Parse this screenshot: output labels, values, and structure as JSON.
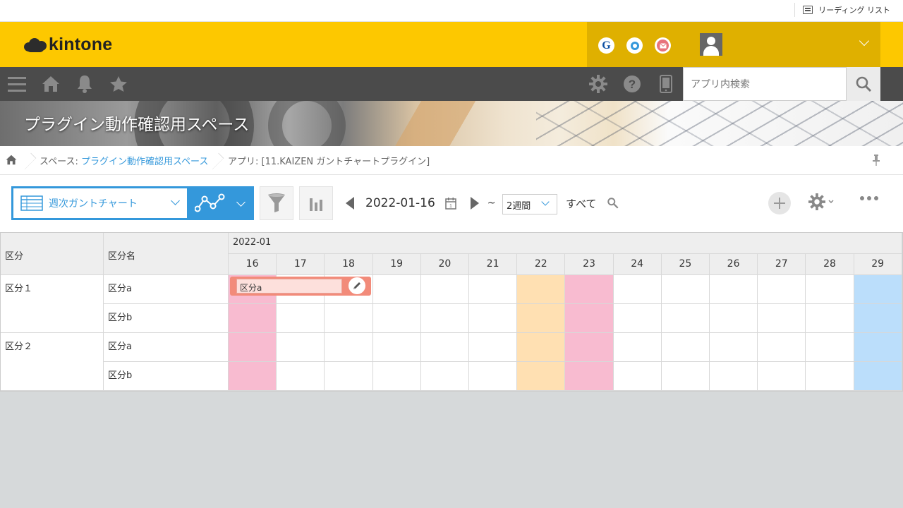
{
  "browser": {
    "reading_list_label": "リーディング リスト"
  },
  "header": {
    "logo_text": "kintone",
    "services": [
      {
        "icon": "garoon-icon",
        "glyph": "G",
        "color": "#0b4ea2"
      },
      {
        "icon": "office-icon",
        "glyph": "",
        "color": "#3498db"
      },
      {
        "icon": "mail-icon",
        "glyph": "",
        "color": "#e8737c"
      }
    ]
  },
  "nav": {
    "search_placeholder": "アプリ内検索"
  },
  "banner": {
    "title": "プラグイン動作確認用スペース"
  },
  "breadcrumb": {
    "space_prefix": "スペース: ",
    "space_link": "プラグイン動作確認用スペース",
    "app": "アプリ: [11.KAIZEN ガントチャートプラグイン]"
  },
  "toolbar": {
    "view_name": "週次ガントチャート",
    "date": "2022-01-16",
    "tilde": "~",
    "period": "2週間",
    "filter_all": "すべて"
  },
  "gantt": {
    "col_category": "区分",
    "col_category_name": "区分名",
    "month": "2022-01",
    "days": [
      {
        "label": "16",
        "color": "#f8bbd0"
      },
      {
        "label": "17",
        "color": ""
      },
      {
        "label": "18",
        "color": ""
      },
      {
        "label": "19",
        "color": ""
      },
      {
        "label": "20",
        "color": ""
      },
      {
        "label": "21",
        "color": ""
      },
      {
        "label": "22",
        "color": "#ffe0b2"
      },
      {
        "label": "23",
        "color": "#f8bbd0"
      },
      {
        "label": "24",
        "color": ""
      },
      {
        "label": "25",
        "color": ""
      },
      {
        "label": "26",
        "color": ""
      },
      {
        "label": "27",
        "color": ""
      },
      {
        "label": "28",
        "color": ""
      },
      {
        "label": "29",
        "color": "#bbdefb"
      }
    ],
    "groups": [
      {
        "name": "区分１",
        "rows": [
          "区分a",
          "区分b"
        ]
      },
      {
        "name": "区分２",
        "rows": [
          "区分a",
          "区分b"
        ]
      }
    ],
    "bar_label": "区分a"
  }
}
